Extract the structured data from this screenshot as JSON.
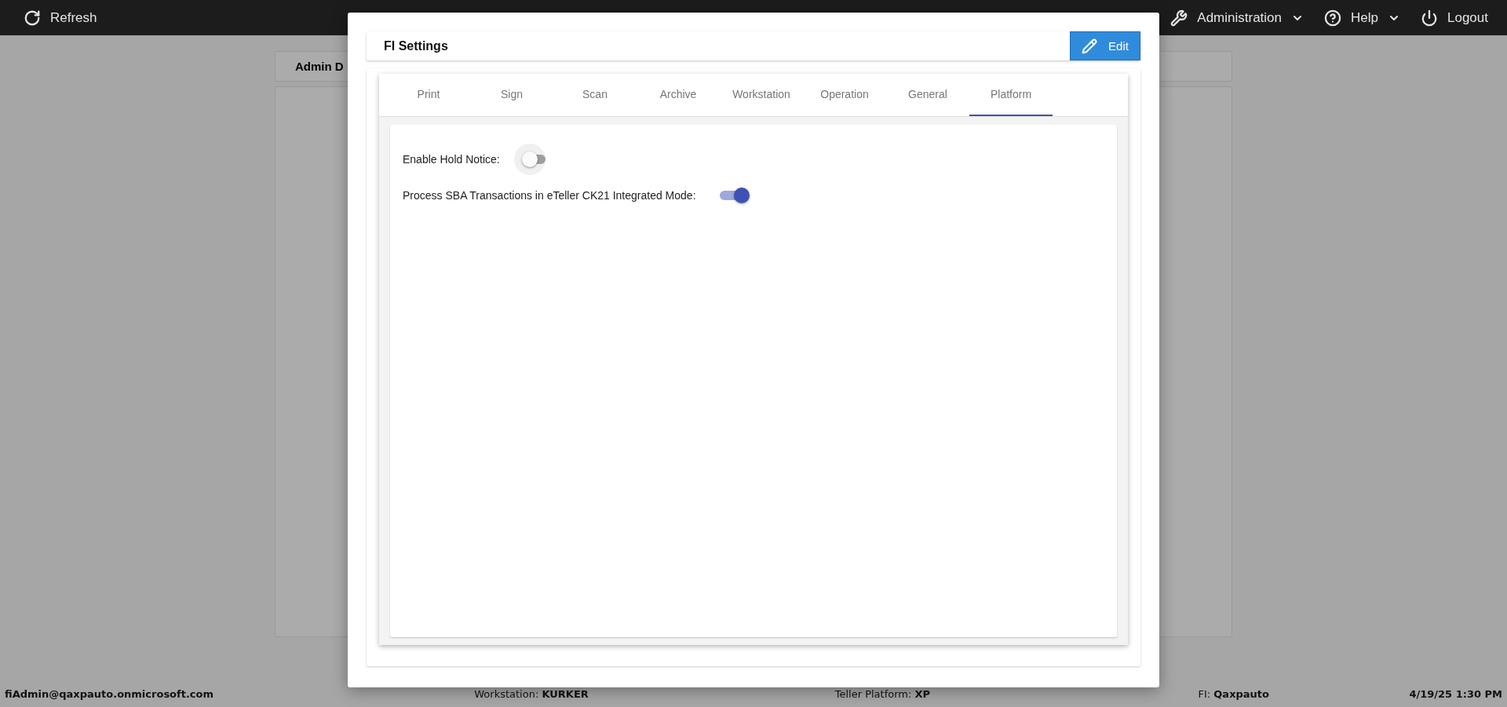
{
  "top_bar": {
    "left": {
      "label": "Refresh"
    },
    "right": [
      {
        "label": "Administration",
        "dropdown": true
      },
      {
        "label": "Help",
        "dropdown": true
      },
      {
        "label": "Logout",
        "dropdown": false
      }
    ]
  },
  "background_panel": {
    "title": "Admin D"
  },
  "modal": {
    "title": "FI Settings",
    "edit_button": "Edit",
    "tabs": [
      {
        "label": "Print",
        "selected": false
      },
      {
        "label": "Sign",
        "selected": false
      },
      {
        "label": "Scan",
        "selected": false
      },
      {
        "label": "Archive",
        "selected": false
      },
      {
        "label": "Workstation",
        "selected": false
      },
      {
        "label": "Operation",
        "selected": false
      },
      {
        "label": "General",
        "selected": false
      },
      {
        "label": "Platform",
        "selected": true
      }
    ],
    "settings": [
      {
        "label": "Enable Hold Notice:",
        "on": false,
        "focused": true
      },
      {
        "label": "Process SBA Transactions in eTeller CK21 Integrated Mode:",
        "on": true,
        "focused": false
      }
    ]
  },
  "status_bar": [
    {
      "text": "**fiAdmin@qaxpauto.onmicrosoft.com**"
    },
    {
      "text": "Workstation: **KURKER**"
    },
    {
      "text": "Teller Platform: **XP**"
    },
    {
      "text": "FI: **Qaxpauto**"
    },
    {
      "text": "**4/19/25 1:30 PM**"
    }
  ]
}
